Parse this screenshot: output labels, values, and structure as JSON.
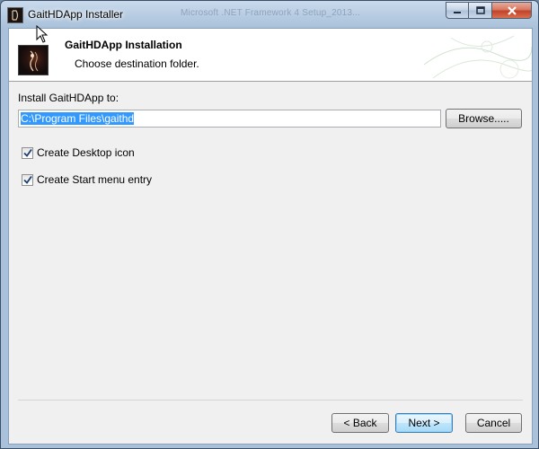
{
  "window": {
    "title": "GaitHDApp Installer",
    "background_title": "Microsoft .NET Framework 4 Setup_2013...",
    "minimize_icon": "minimize-icon",
    "maximize_icon": "maximize-icon",
    "close_icon": "close-icon"
  },
  "header": {
    "title": "GaitHDApp Installation",
    "subtitle": "Choose destination folder."
  },
  "install": {
    "label": "Install GaitHDApp to:",
    "path": "C:\\Program Files\\gaithd",
    "browse_label": "Browse....."
  },
  "options": [
    {
      "label": "Create Desktop icon",
      "checked": true
    },
    {
      "label": "Create Start menu entry",
      "checked": true
    }
  ],
  "footer": {
    "back_label": "< Back",
    "next_label": "Next >",
    "cancel_label": "Cancel"
  },
  "colors": {
    "selection": "#3399ff",
    "close_button": "#c2422a",
    "default_button_border": "#3c7fb1"
  }
}
